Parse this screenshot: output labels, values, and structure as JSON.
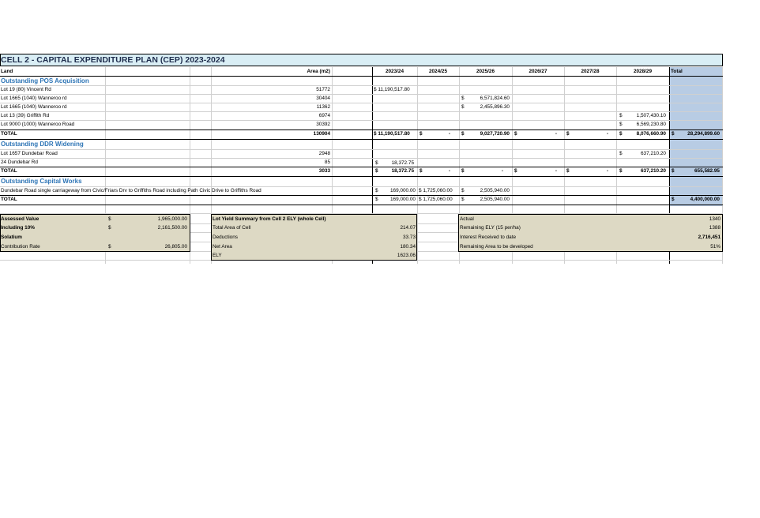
{
  "sheet": {
    "title": "CELL 2 - CAPITAL EXPENDITURE PLAN (CEP) 2023-2024",
    "colors": {
      "title_bg": "#d9eef5",
      "total_col_bg": "#b8cce4",
      "summary_bg": "#ddd9c4",
      "section_text": "#2e75b6"
    },
    "headers": {
      "land": "Land",
      "area": "Area (m2)",
      "years": [
        "2023/24",
        "2024/25",
        "2025/26",
        "2026/27",
        "2027/28",
        "2028/29"
      ],
      "total": "Total"
    },
    "pos": {
      "heading": "Outstanding POS Acquisition",
      "rows": [
        {
          "land": "Lot 19 (80) Vincent Rd",
          "area": "51772",
          "y1": "$ 11,190,517.80",
          "y3c": "",
          "y3": "",
          "y6c": "",
          "y6": ""
        },
        {
          "land": "Lot 1665 (1040) Wanneroo rd",
          "area": "30404",
          "y1": "",
          "y3c": "$",
          "y3": "6,571,824.60",
          "y6c": "",
          "y6": ""
        },
        {
          "land": "Lot 1665 (1040) Wanneroo rd",
          "area": "11362",
          "y1": "",
          "y3c": "$",
          "y3": "2,455,896.30",
          "y6c": "",
          "y6": ""
        },
        {
          "land": "Lot 13 (39) Griffith Rd",
          "area": "6974",
          "y1": "",
          "y3c": "",
          "y3": "",
          "y6c": "$",
          "y6": "1,507,430.10"
        },
        {
          "land": "Lot 9000 (1000) Wanneroo Road",
          "area": "30392",
          "y1": "",
          "y3c": "",
          "y3": "",
          "y6c": "$",
          "y6": "6,569,230.80"
        }
      ],
      "total": {
        "label": "TOTAL",
        "area": "130904",
        "y1": "$ 11,190,517.80",
        "y2c": "$",
        "y2": "-",
        "y3c": "$",
        "y3": "9,027,720.90",
        "y4c": "$",
        "y4": "-",
        "y5c": "$",
        "y5": "-",
        "y6c": "$",
        "y6": "8,076,660.90",
        "tc": "$",
        "t": "28,294,899.60"
      }
    },
    "ddr": {
      "heading": "Outstanding DDR Widening",
      "rows": [
        {
          "land": "Lot 1657 Dundebar Road",
          "area": "2948",
          "y1c": "",
          "y1": "",
          "y6c": "$",
          "y6": "637,210.20"
        },
        {
          "land": "24 Dundebar Rd",
          "area": "85",
          "y1c": "$",
          "y1": "18,372.75",
          "y6c": "",
          "y6": ""
        }
      ],
      "total": {
        "label": "TOTAL",
        "area": "3033",
        "y1c": "$",
        "y1": "18,372.75",
        "y2c": "$",
        "y2": "-",
        "y3c": "$",
        "y3": "-",
        "y4c": "$",
        "y4": "-",
        "y5c": "$",
        "y5": "-",
        "y6c": "$",
        "y6": "637,210.20",
        "tc": "$",
        "t": "655,582.95"
      }
    },
    "works": {
      "heading": "Outstanding Capital Works",
      "row": {
        "land": "Dundebar Road single carriageway from Civic/Friars Drv to Griffiths Road including Path Civic Drive to Griffiths Road",
        "y1c": "$",
        "y1": "169,000.00",
        "y2": "$ 1,725,060.00",
        "y3c": "$",
        "y3": "2,505,940.00"
      },
      "total": {
        "label": "TOTAL",
        "y1c": "$",
        "y1": "169,000.00",
        "y2": "$ 1,725,060.00",
        "y3c": "$",
        "y3": "2,505,940.00",
        "tc": "$",
        "t": "4,400,000.00"
      }
    },
    "valuation": [
      {
        "label": "Assessed Value",
        "cur": "$",
        "value": "1,965,000.00",
        "bold": true
      },
      {
        "label": "Including 10%",
        "cur": "$",
        "value": "2,161,500.00",
        "bold": true
      },
      {
        "label": "Solatium",
        "cur": "",
        "value": "",
        "bold": true
      },
      {
        "label": "Contribution Rate",
        "cur": "$",
        "value": "26,805.00",
        "bold": false
      }
    ],
    "lot_yield": {
      "heading": "Lot Yield Summary from Cell 2 ELY (whole Cell)",
      "rows": [
        {
          "label": "Total Area of Cell",
          "value": "214.07"
        },
        {
          "label": "Deductions",
          "value": "33.73"
        },
        {
          "label": "Net Area",
          "value": "180.34"
        },
        {
          "label": "ELY",
          "value": "1623.06"
        }
      ]
    },
    "stats": [
      {
        "label": "Actual",
        "value": "1340",
        "bold": false
      },
      {
        "label": "Remaining ELY (15 per/ha)",
        "value": "1388",
        "bold": false
      },
      {
        "label": "Interest Received to date",
        "value": "2,716,451",
        "bold": true
      },
      {
        "label": "Remaining Area to be developed",
        "value": "51%",
        "bold": false
      }
    ]
  }
}
